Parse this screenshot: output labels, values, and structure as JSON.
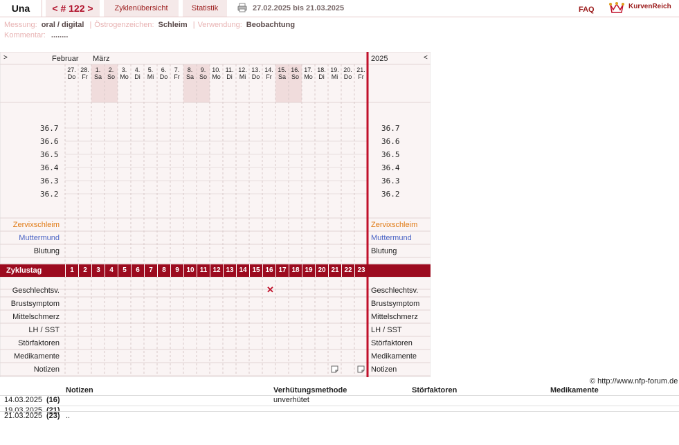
{
  "tabs": {
    "user": "Una",
    "cycle": "< # 122 >",
    "overview": "Zyklenübersicht",
    "statistics": "Statistik"
  },
  "date_range": "27.02.2025 bis 21.03.2025",
  "faq": "FAQ",
  "logo": {
    "text": "KurvenReich",
    "icon": "crown-icon"
  },
  "meta": {
    "measure_key": "Messung:",
    "measure_val": "oral / digital",
    "estrogen_key": "Östrogenzeichen:",
    "estrogen_val": "Schleim",
    "use_key": "Verwendung:",
    "use_val": "Beobachtung",
    "comment_key": "Kommentar:",
    "comment_val": "........"
  },
  "chart": {
    "nav_left": ">",
    "nav_right": "<",
    "month_feb": "Februar",
    "month_mar": "März",
    "year": "2025",
    "days": [
      {
        "d": "27.",
        "w": "Do",
        "we": false
      },
      {
        "d": "28.",
        "w": "Fr",
        "we": false
      },
      {
        "d": "1.",
        "w": "Sa",
        "we": true
      },
      {
        "d": "2.",
        "w": "So",
        "we": true
      },
      {
        "d": "3.",
        "w": "Mo",
        "we": false
      },
      {
        "d": "4.",
        "w": "Di",
        "we": false
      },
      {
        "d": "5.",
        "w": "Mi",
        "we": false
      },
      {
        "d": "6.",
        "w": "Do",
        "we": false
      },
      {
        "d": "7.",
        "w": "Fr",
        "we": false
      },
      {
        "d": "8.",
        "w": "Sa",
        "we": true
      },
      {
        "d": "9.",
        "w": "So",
        "we": true
      },
      {
        "d": "10.",
        "w": "Mo",
        "we": false
      },
      {
        "d": "11.",
        "w": "Di",
        "we": false
      },
      {
        "d": "12.",
        "w": "Mi",
        "we": false
      },
      {
        "d": "13.",
        "w": "Do",
        "we": false
      },
      {
        "d": "14.",
        "w": "Fr",
        "we": false
      },
      {
        "d": "15.",
        "w": "Sa",
        "we": true
      },
      {
        "d": "16.",
        "w": "So",
        "we": true
      },
      {
        "d": "17.",
        "w": "Mo",
        "we": false
      },
      {
        "d": "18.",
        "w": "Di",
        "we": false
      },
      {
        "d": "19.",
        "w": "Mi",
        "we": false
      },
      {
        "d": "20.",
        "w": "Do",
        "we": false
      },
      {
        "d": "21.",
        "w": "Fr",
        "we": false
      }
    ],
    "temps": [
      "36.7",
      "36.6",
      "36.5",
      "36.4",
      "36.3",
      "36.2"
    ],
    "rows_top": [
      {
        "label": "Zervixschleim",
        "color": "#e07a14"
      },
      {
        "label": "Muttermund",
        "color": "#4a63c4"
      },
      {
        "label": "Blutung",
        "color": "#222222"
      }
    ],
    "zyklustag_label": "Zyklustag",
    "zyklustage": [
      "1",
      "2",
      "3",
      "4",
      "5",
      "6",
      "7",
      "8",
      "9",
      "10",
      "11",
      "12",
      "13",
      "14",
      "15",
      "16",
      "17",
      "18",
      "19",
      "20",
      "21",
      "22",
      "23"
    ],
    "rows_bottom": [
      {
        "label": "Geschlechtsv."
      },
      {
        "label": "Brustsymptom"
      },
      {
        "label": "Mittelschmerz"
      },
      {
        "label": "LH / SST"
      },
      {
        "label": "Störfaktoren"
      },
      {
        "label": "Medikamente"
      },
      {
        "label": "Notizen"
      }
    ],
    "intercourse_mark": {
      "day_index": 15,
      "symbol": "✕"
    },
    "note_marks": [
      20,
      22
    ]
  },
  "copyright": "© http://www.nfp-forum.de",
  "notes": {
    "headers": [
      "Notizen",
      "Verhütungsmethode",
      "Störfaktoren",
      "Medikamente"
    ],
    "rows": [
      {
        "date": "14.03.2025",
        "day": "(16)",
        "note": "",
        "method": "unverhütet"
      },
      {
        "date": "19.03.2025",
        "day": "(21)",
        "note": "",
        "method": ""
      },
      {
        "date": "21.03.2025",
        "day": "(23)",
        "note": "..",
        "method": ""
      }
    ]
  }
}
